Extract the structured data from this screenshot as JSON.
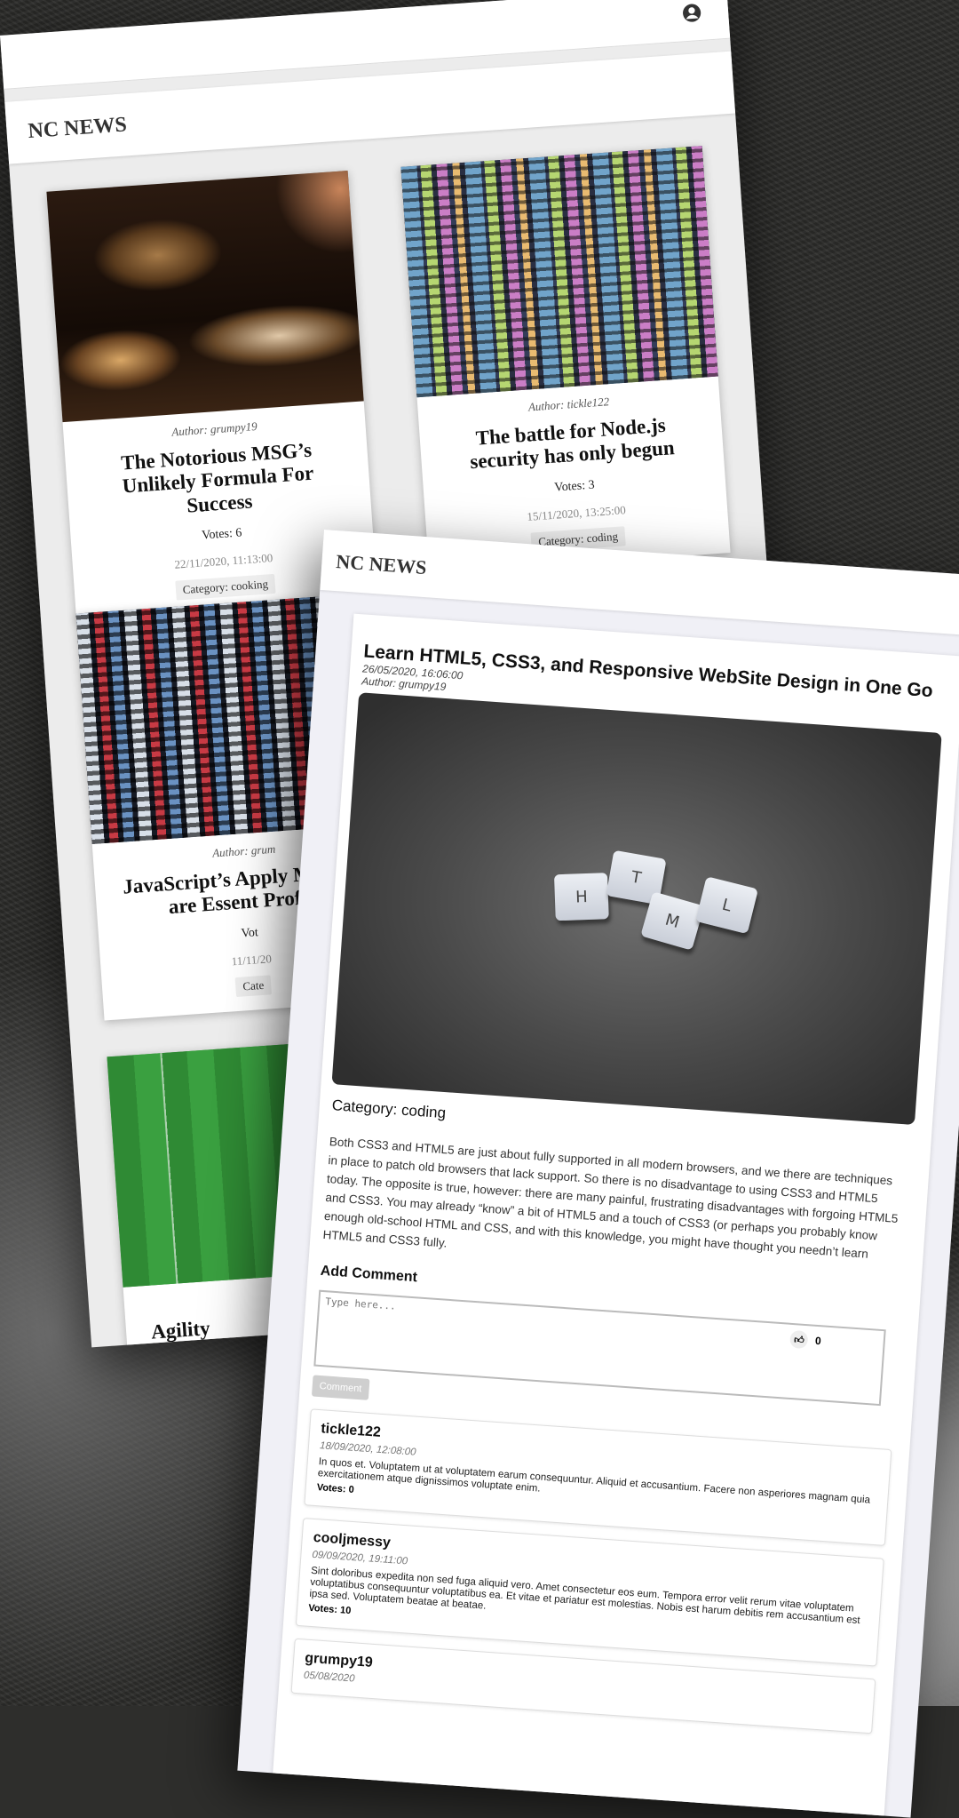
{
  "list_page": {
    "logo": "NC NEWS",
    "cards": [
      {
        "author": "Author: grumpy19",
        "title": "The Notorious MSG’s Unlikely Formula For Success",
        "votes": "Votes: 6",
        "date": "22/11/2020, 11:13:00",
        "category": "Category: cooking",
        "image": "cooking-photo"
      },
      {
        "author": "Author: tickle122",
        "title": "The battle for Node.js security has only begun",
        "votes": "Votes: 3",
        "date": "15/11/2020, 13:25:00",
        "category": "Category: coding",
        "image": "code-photo"
      },
      {
        "author": "Author: grum",
        "title": "JavaScript’s Apply Methods are Essent Profess",
        "votes": "Vot",
        "date": "11/11/20",
        "category": "Cate",
        "image": "code-photo-red"
      },
      {
        "author": "",
        "title": "Agility",
        "votes": "",
        "date": "",
        "category": "",
        "image": "football-pitch-photo"
      }
    ]
  },
  "detail_page": {
    "logo": "NC NEWS",
    "title": "Learn HTML5, CSS3, and Responsive WebSite Design in One Go",
    "date": "26/05/2020, 16:06:00",
    "author": "Author: grumpy19",
    "image_keys": [
      "H",
      "T",
      "M",
      "L"
    ],
    "category": "Category: coding",
    "body": "Both CSS3 and HTML5 are just about fully supported in all modern browsers, and we there are techniques in place to patch old browsers that lack support. So there is no disadvantage to using CSS3 and HTML5 today. The opposite is true, however: there are many painful, frustrating disadvantages with forgoing HTML5 and CSS3. You may already “know” a bit of HTML5 and a touch of CSS3 (or perhaps you probably know enough old-school HTML and CSS, and with this knowledge, you might have thought you needn’t learn HTML5 and CSS3 fully.",
    "votes": "0",
    "add_comment": {
      "title": "Add Comment",
      "placeholder": "Type here...",
      "button": "Comment"
    },
    "comments": [
      {
        "author": "tickle122",
        "date": "18/09/2020, 12:08:00",
        "body": "In quos et. Voluptatem ut at voluptatem earum consequuntur. Aliquid et accusantium. Facere non asperiores magnam quia exercitationem atque dignissimos voluptate enim.",
        "votes": "Votes: 0"
      },
      {
        "author": "cooljmessy",
        "date": "09/09/2020, 19:11:00",
        "body": "Sint doloribus expedita non sed fuga aliquid vero. Amet consectetur eos eum. Tempora error velit rerum vitae voluptatem voluptatibus consequuntur voluptatibus ea. Et vitae et pariatur est molestias. Nobis est harum debitis rem accusantium est ipsa sed. Voluptatem beatae at beatae.",
        "votes": "Votes: 10"
      },
      {
        "author": "grumpy19",
        "date": "05/08/2020",
        "body": "",
        "votes": ""
      }
    ]
  },
  "colors": {
    "page_bg": "#f0f0f6",
    "card_bg": "#ffffff",
    "button_disabled": "#cfcfcf"
  },
  "icons": {
    "user": "user-circle-icon",
    "like": "thumbs-up-icon"
  }
}
